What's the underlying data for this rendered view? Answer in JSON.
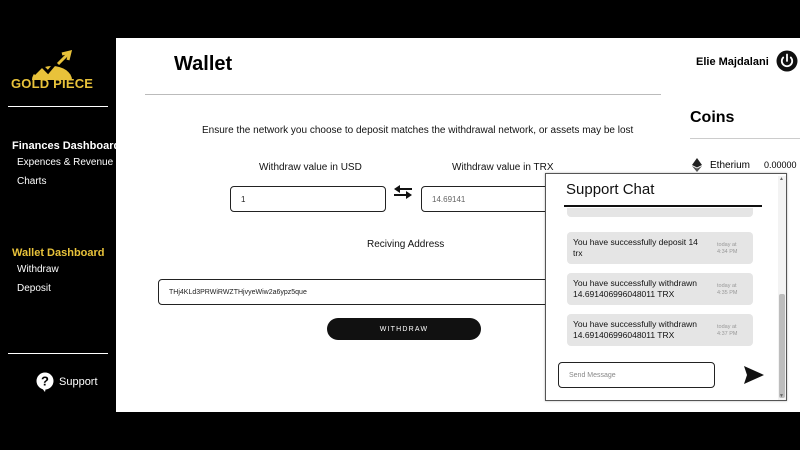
{
  "brand": {
    "name": "GOLD PIECE",
    "color": "#e8c23a"
  },
  "sidebar": {
    "finances_heading": "Finances Dashboard",
    "finances_items": [
      "Expences & Revenue",
      "Charts"
    ],
    "wallet_heading": "Wallet Dashboard",
    "wallet_items": [
      "Withdraw",
      "Deposit"
    ],
    "support_label": "Support"
  },
  "header": {
    "title": "Wallet",
    "user_name": "Elie Majdalani"
  },
  "form": {
    "notice": "Ensure the network you choose to deposit matches the withdrawal network, or assets may be lost",
    "usd_label": "Withdraw value in USD",
    "usd_value": "1",
    "trx_label": "Withdraw value in TRX",
    "trx_value": "14.69141",
    "address_label": "Reciving Address",
    "address_value": "THj4KLd3PRWiRWZTHjvyeWiw2a6ypz5que",
    "withdraw_button": "WITHDRAW"
  },
  "coins": {
    "title": "Coins",
    "items": [
      {
        "name": "Etherium",
        "value": "0.00000"
      }
    ]
  },
  "chat": {
    "title": "Support Chat",
    "messages": [
      {
        "text": "You have successfully deposit 14 trx",
        "time": "today at 4:34 PM"
      },
      {
        "text": "You have successfully withdrawn 14.691406996048011 TRX",
        "time": "today at 4:35 PM"
      },
      {
        "text": "You have successfully withdrawn 14.691406996048011 TRX",
        "time": "today at 4:37 PM"
      }
    ],
    "input_placeholder": "Send Message"
  }
}
